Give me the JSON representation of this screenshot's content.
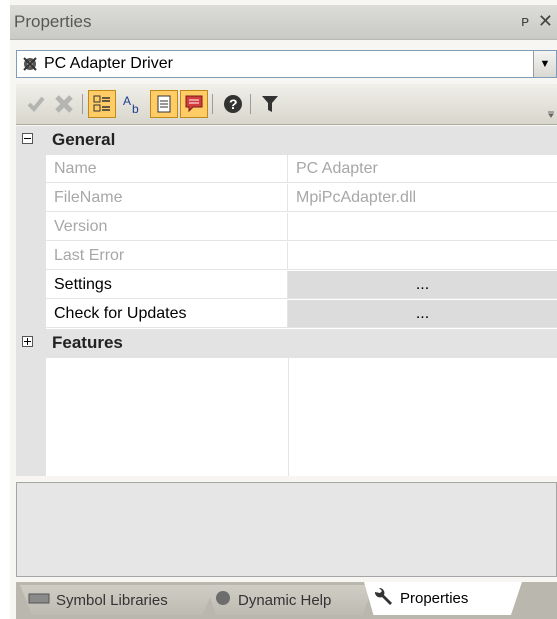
{
  "window": {
    "title": "Properties",
    "pin_glyph": "ᴩ",
    "close_glyph": "✕"
  },
  "selector": {
    "value": "PC Adapter Driver",
    "icon": "driver-icon"
  },
  "toolbar": {
    "buttons": [
      {
        "name": "apply-button",
        "icon": "checkmark-icon"
      },
      {
        "name": "cancel-button",
        "icon": "x-icon"
      },
      {
        "name": "categorized-button",
        "icon": "categorized-icon",
        "active": true
      },
      {
        "name": "alphabetical-button",
        "icon": "alphabetical-icon"
      },
      {
        "name": "property-pages-button",
        "icon": "property-pages-icon",
        "active": true
      },
      {
        "name": "description-button",
        "icon": "description-icon",
        "active": true
      },
      {
        "name": "help-button",
        "icon": "help-icon"
      },
      {
        "name": "filter-button",
        "icon": "filter-icon"
      }
    ]
  },
  "grid": {
    "general": {
      "label": "General",
      "toggle": "−"
    },
    "rows": [
      {
        "name": "Name",
        "value": "PC Adapter"
      },
      {
        "name": "FileName",
        "value": "MpiPcAdapter.dll"
      },
      {
        "name": "Version",
        "value": ""
      },
      {
        "name": "Last Error",
        "value": ""
      },
      {
        "name": "Settings",
        "value": "..."
      },
      {
        "name": "Check for Updates",
        "value": "..."
      }
    ],
    "features": {
      "label": "Features",
      "toggle": "+"
    }
  },
  "tabs": [
    {
      "label": "Symbol Libraries",
      "icon": "library-icon"
    },
    {
      "label": "Dynamic Help",
      "icon": "help-globe-icon"
    },
    {
      "label": "Properties",
      "icon": "wrench-icon",
      "active": true
    }
  ]
}
